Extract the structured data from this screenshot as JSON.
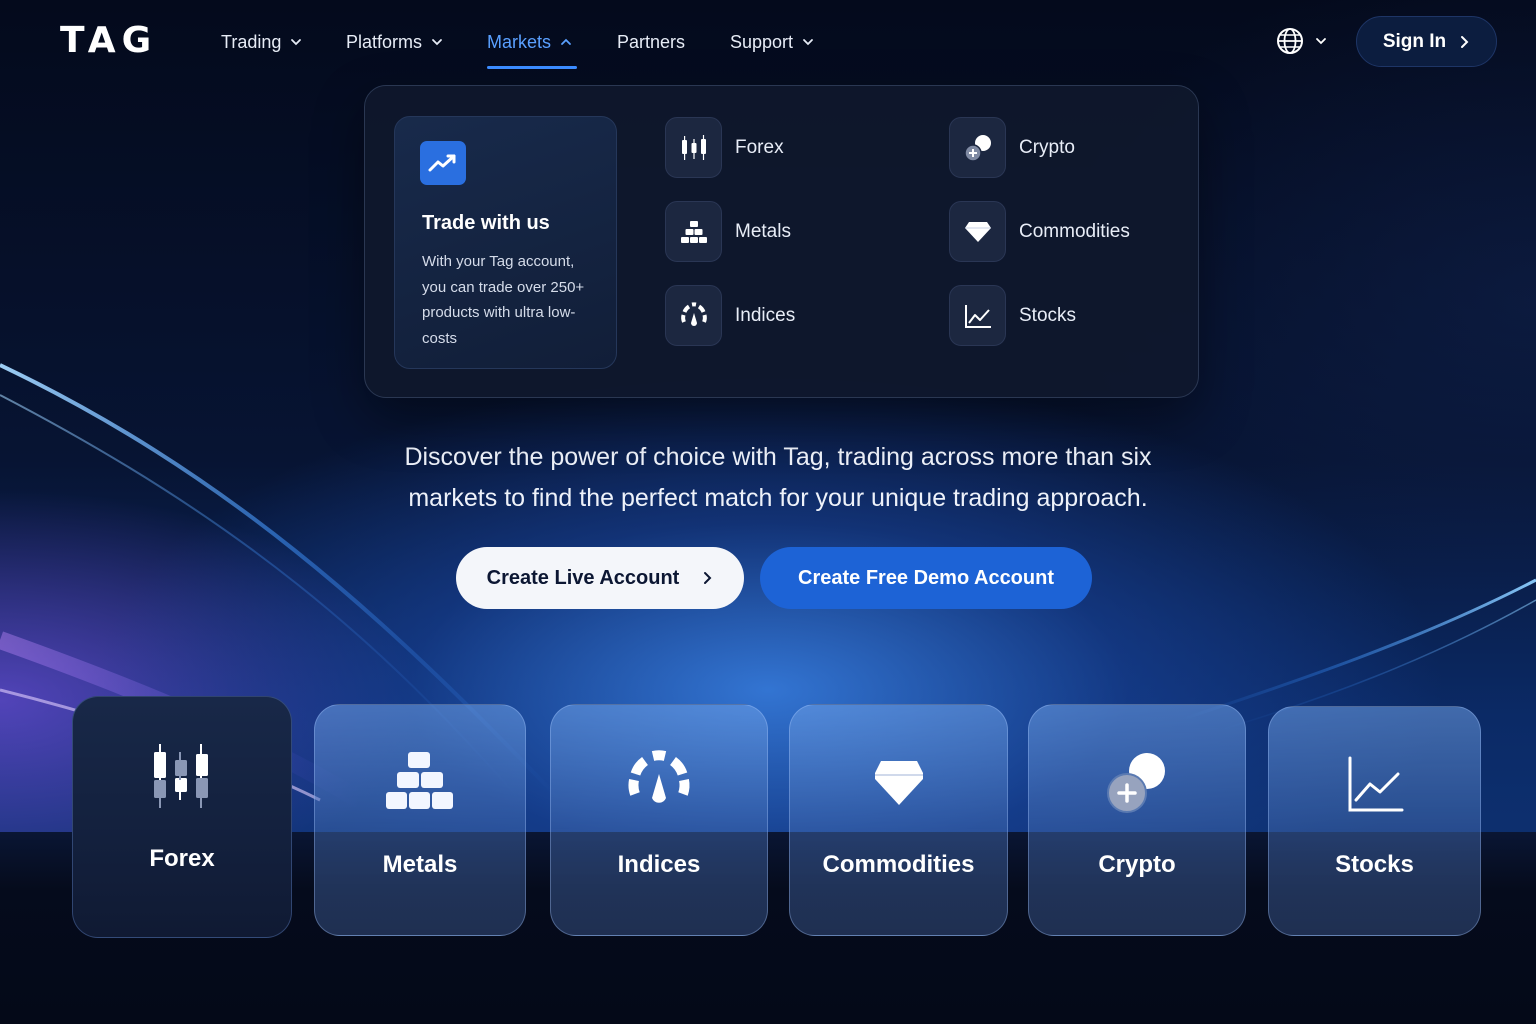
{
  "brand": {
    "logo": "TAG"
  },
  "nav": {
    "items": [
      {
        "label": "Trading",
        "has_menu": true
      },
      {
        "label": "Platforms",
        "has_menu": true
      },
      {
        "label": "Markets",
        "has_menu": true,
        "active": true
      },
      {
        "label": "Partners",
        "has_menu": false
      },
      {
        "label": "Support",
        "has_menu": true
      }
    ],
    "language_icon": "globe-icon",
    "sign_in_label": "Sign In"
  },
  "markets_menu": {
    "promo": {
      "icon": "trend-chart-icon",
      "title": "Trade with us",
      "text": "With your Tag account, you can trade over 250+ products with ultra low-costs"
    },
    "items": [
      {
        "label": "Forex",
        "icon": "candlestick-icon"
      },
      {
        "label": "Crypto",
        "icon": "coins-icon"
      },
      {
        "label": "Metals",
        "icon": "gold-bars-icon"
      },
      {
        "label": "Commodities",
        "icon": "gem-icon"
      },
      {
        "label": "Indices",
        "icon": "gauge-icon"
      },
      {
        "label": "Stocks",
        "icon": "line-chart-icon"
      }
    ]
  },
  "hero": {
    "text": "Discover the power of choice with Tag, trading across more than six markets to find the perfect match for your unique trading approach.",
    "cta_live": "Create Live Account",
    "cta_demo": "Create Free Demo Account"
  },
  "market_cards": [
    {
      "label": "Forex",
      "icon": "candlestick-icon",
      "selected": true
    },
    {
      "label": "Metals",
      "icon": "gold-bars-icon"
    },
    {
      "label": "Indices",
      "icon": "gauge-icon"
    },
    {
      "label": "Commodities",
      "icon": "gem-icon"
    },
    {
      "label": "Crypto",
      "icon": "coins-icon"
    },
    {
      "label": "Stocks",
      "icon": "line-chart-icon"
    }
  ],
  "colors": {
    "background": "#050b1c",
    "accent": "#3b8bff",
    "demo_button": "#1d63d6",
    "live_button": "#f4f6fa"
  }
}
